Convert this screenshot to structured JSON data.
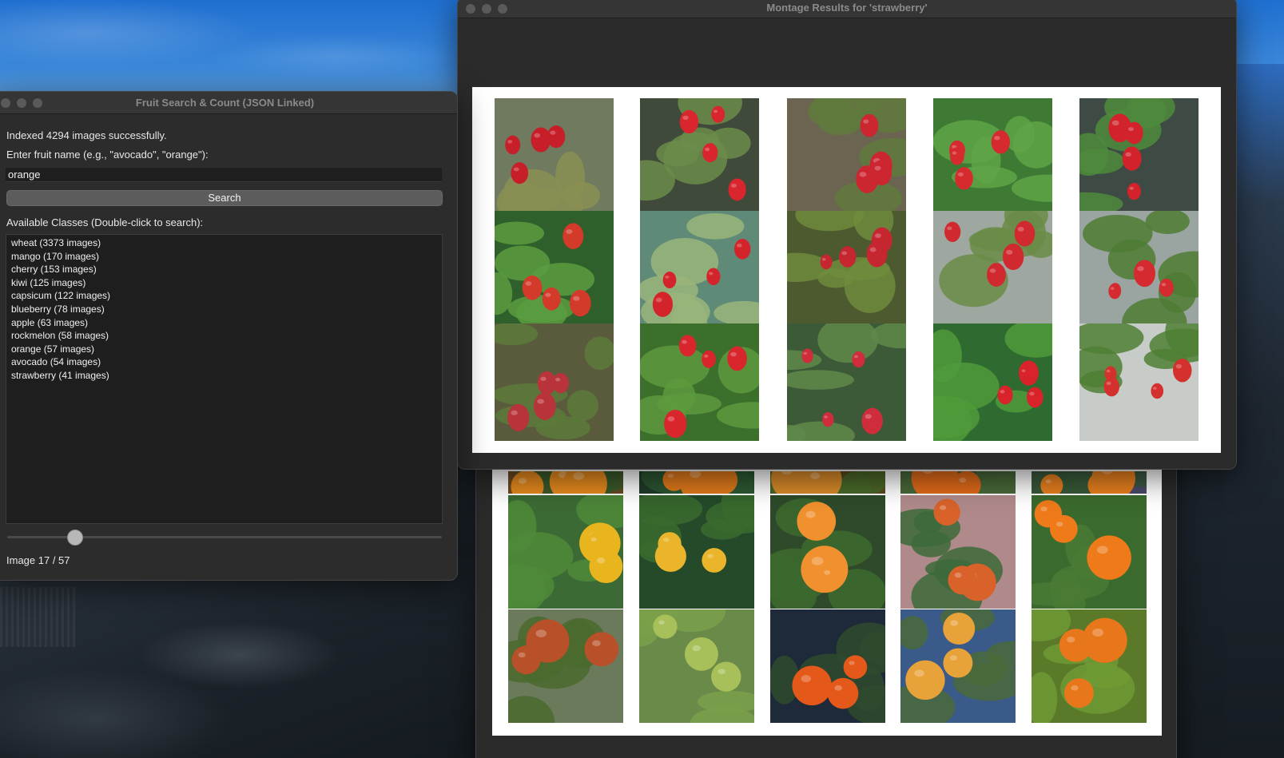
{
  "search_window": {
    "title": "Fruit Search & Count (JSON Linked)",
    "status": "Indexed 4294 images successfully.",
    "prompt": "Enter fruit name (e.g., \"avocado\", \"orange\"):",
    "input_value": "orange",
    "search_label": "Search",
    "classes_label": "Available Classes (Double-click to search):",
    "classes": [
      "wheat (3373 images)",
      "mango (170 images)",
      "cherry (153 images)",
      "kiwi (125 images)",
      "capsicum (122 images)",
      "blueberry (78 images)",
      "apple (63 images)",
      "rockmelon (58 images)",
      "orange (57 images)",
      "avocado (54 images)",
      "strawberry (41 images)"
    ],
    "slider_value": 17,
    "slider_max": 57,
    "image_counter": "Image 17 / 57"
  },
  "montage_window": {
    "title": "Montage Results for 'strawberry'",
    "tiles": [
      {
        "kind": "strawberry",
        "bg": "#6f7a5f",
        "leaf": "#8a8f52",
        "fruit": "#c61f2a"
      },
      {
        "kind": "strawberry",
        "bg": "#3f4a3a",
        "leaf": "#6b8c4a",
        "fruit": "#d8252e"
      },
      {
        "kind": "strawberry",
        "bg": "#6b6450",
        "leaf": "#5f7a3c",
        "fruit": "#cc2631"
      },
      {
        "kind": "strawberry",
        "bg": "#3f7a34",
        "leaf": "#5fa548",
        "fruit": "#d62b2e"
      },
      {
        "kind": "strawberry",
        "bg": "#3e4a44",
        "leaf": "#4d8a3c",
        "fruit": "#d2232c"
      },
      {
        "kind": "strawberry",
        "bg": "#2f5f2a",
        "leaf": "#5a9c40",
        "fruit": "#d33a2a"
      },
      {
        "kind": "strawberry",
        "bg": "#5f8a78",
        "leaf": "#9ab57a",
        "fruit": "#d4242b"
      },
      {
        "kind": "strawberry",
        "bg": "#4d5a30",
        "leaf": "#6e8c3c",
        "fruit": "#c52630"
      },
      {
        "kind": "strawberry",
        "bg": "#9fa8a0",
        "leaf": "#6a8c46",
        "fruit": "#d02a30"
      },
      {
        "kind": "strawberry",
        "bg": "#9aa4a0",
        "leaf": "#4e7c32",
        "fruit": "#d52a2f"
      },
      {
        "kind": "strawberry",
        "bg": "#5a5a3c",
        "leaf": "#5c7a3a",
        "fruit": "#b8333a"
      },
      {
        "kind": "strawberry",
        "bg": "#3c6f2c",
        "leaf": "#5d9a3e",
        "fruit": "#d9262c"
      },
      {
        "kind": "strawberry",
        "bg": "#3d5a38",
        "leaf": "#5f8a4a",
        "fruit": "#cf2c3c"
      },
      {
        "kind": "strawberry",
        "bg": "#2f6a30",
        "leaf": "#4f9a3a",
        "fruit": "#d8232a"
      },
      {
        "kind": "strawberry",
        "bg": "#c8ccc8",
        "leaf": "#4f7f34",
        "fruit": "#d4302e"
      }
    ]
  },
  "orange_window": {
    "tiles": [
      {
        "kind": "orange",
        "bg": "#6b4a22",
        "leaf": "#3a5a2a",
        "fruit": "#e58a1e"
      },
      {
        "kind": "orange",
        "bg": "#203a2a",
        "leaf": "#2e5a34",
        "fruit": "#e07a1a"
      },
      {
        "kind": "orange",
        "bg": "#5a4a1e",
        "leaf": "#4a6a2a",
        "fruit": "#d88a2a"
      },
      {
        "kind": "orange",
        "bg": "#3a5a3a",
        "leaf": "#4a6a3a",
        "fruit": "#e06a1a"
      },
      {
        "kind": "orange",
        "bg": "#4a4a6a",
        "leaf": "#3a5a3a",
        "fruit": "#e8801e"
      },
      {
        "kind": "orange",
        "bg": "#3c6a34",
        "leaf": "#4f8a3a",
        "fruit": "#e8b51e"
      },
      {
        "kind": "orange",
        "bg": "#244a2a",
        "leaf": "#3a6a2e",
        "fruit": "#eab52a"
      },
      {
        "kind": "orange",
        "bg": "#2e4a2a",
        "leaf": "#3c6a2e",
        "fruit": "#f0902e"
      },
      {
        "kind": "orange",
        "bg": "#b08a8a",
        "leaf": "#3d6a3a",
        "fruit": "#d8622a"
      },
      {
        "kind": "orange",
        "bg": "#3a6a2e",
        "leaf": "#4a7a34",
        "fruit": "#ee7a1a"
      },
      {
        "kind": "orange",
        "bg": "#6a7a5a",
        "leaf": "#4a6a2e",
        "fruit": "#b8502a"
      },
      {
        "kind": "orange",
        "bg": "#6a8a4a",
        "leaf": "#7aa04a",
        "fruit": "#a8c05a"
      },
      {
        "kind": "orange",
        "bg": "#1e2a3a",
        "leaf": "#2f4a2e",
        "fruit": "#e4581a"
      },
      {
        "kind": "orange",
        "bg": "#3a5a8a",
        "leaf": "#4a6a3a",
        "fruit": "#e8a23a"
      },
      {
        "kind": "orange",
        "bg": "#5a7a2a",
        "leaf": "#6e9a34",
        "fruit": "#e8761a"
      }
    ]
  }
}
